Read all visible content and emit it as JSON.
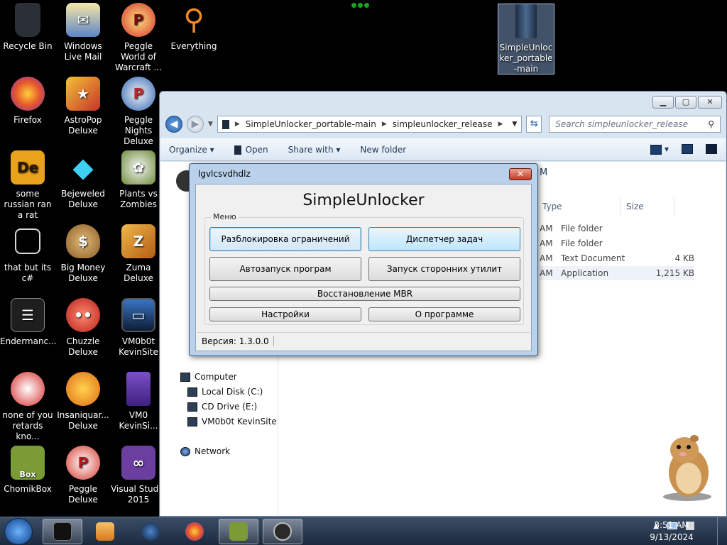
{
  "desktop": {
    "icons": [
      {
        "label": "Recycle Bin",
        "color": "#2b2f36"
      },
      {
        "label": "Windows Live Mail",
        "color": "#5c86c6"
      },
      {
        "label": "Peggle World of Warcraft ...",
        "color": "#d2322a"
      },
      {
        "label": "Everything",
        "color": "#e8731d"
      },
      {
        "label": "Firefox",
        "color": "#e5562b"
      },
      {
        "label": "AstroPop Deluxe",
        "color": "#c8332d"
      },
      {
        "label": "Peggle Nights Deluxe",
        "color": "#2e66b5"
      },
      {
        "label": "some russian ran a rat",
        "color": "#e8a21b"
      },
      {
        "label": "Bejeweled Deluxe",
        "color": "#22a8d8"
      },
      {
        "label": "Plants vs Zombies",
        "color": "#6e8b3a"
      },
      {
        "label": "that but its c#",
        "color": "#d9d9d9"
      },
      {
        "label": "Big Money Deluxe",
        "color": "#a97a3a"
      },
      {
        "label": "Zuma Deluxe",
        "color": "#d4821d"
      },
      {
        "label": "Endermanc...",
        "color": "#1e1e1e"
      },
      {
        "label": "Chuzzle Deluxe",
        "color": "#d23a2f"
      },
      {
        "label": "VM0b0t KevinSite",
        "color": "#1c3a62"
      },
      {
        "label": "none of you retards kno...",
        "color": "#d52b2b"
      },
      {
        "label": "Insaniquar... Deluxe",
        "color": "#e98b24"
      },
      {
        "label": "VM0 KevinSi...",
        "color": "#6d3fb4"
      },
      {
        "label": "ChomikBox",
        "color": "#7a9b35"
      },
      {
        "label": "Peggle Deluxe",
        "color": "#d3372c"
      },
      {
        "label": "Visual Studio 2015",
        "color": "#6b3fa0"
      },
      {
        "label": "SimpleUnlocker_portable-main",
        "color": "#1d2b3f"
      }
    ]
  },
  "explorer": {
    "breadcrumb": [
      "SimpleUnlocker_portable-main",
      "simpleunlocker_release"
    ],
    "search_placeholder": "Search simpleunlocker_release",
    "commands": {
      "organize": "Organize",
      "open": "Open",
      "share_with": "Share with",
      "new_folder": "New folder"
    },
    "columns": {
      "type": "Type",
      "size": "Size"
    },
    "files": [
      {
        "time": "AM",
        "type": "File folder",
        "size": ""
      },
      {
        "time": "AM",
        "type": "File folder",
        "size": ""
      },
      {
        "time": "AM",
        "type": "Text Document",
        "size": "4 KB"
      },
      {
        "time": "AM",
        "type": "Application",
        "size": "1,215 KB"
      }
    ],
    "header_fragment": "M",
    "nav": {
      "computer": "Computer",
      "drives": [
        "Local Disk (C:)",
        "CD Drive (E:)",
        "VM0b0t KevinSite"
      ],
      "network": "Network"
    }
  },
  "dialog": {
    "window_title": "lgvlcsvdhdlz",
    "close_label": "✕",
    "app_title": "SimpleUnlocker",
    "group_label": "Меню",
    "buttons": {
      "unlock_restrictions": "Разблокировка ограничений",
      "task_manager": "Диспетчер задач",
      "autorun": "Автозапуск програм",
      "third_party": "Запуск сторонних утилит",
      "restore_mbr": "Восстановление MBR",
      "settings": "Настройки",
      "about": "О программе"
    },
    "status_version": "Версия: 1.3.0.0"
  },
  "taskbar": {
    "time": "8:51 AM",
    "date": "9/13/2024"
  }
}
